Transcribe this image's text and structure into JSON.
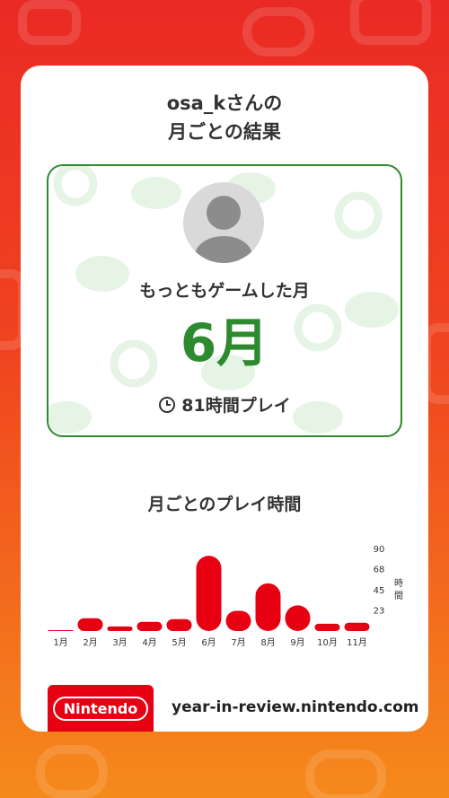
{
  "header": {
    "user_line": "osa_kさんの",
    "subtitle_line": "月ごとの結果"
  },
  "highlight": {
    "label": "もっともゲームした月",
    "month": "6月",
    "hours": "81時間プレイ"
  },
  "chart_data": {
    "type": "bar",
    "title": "月ごとのプレイ時間",
    "ylabel": "時間",
    "categories": [
      "1月",
      "2月",
      "3月",
      "4月",
      "5月",
      "6月",
      "7月",
      "8月",
      "9月",
      "10月",
      "11月"
    ],
    "values": [
      0.5,
      14,
      5,
      10,
      13,
      82,
      22,
      52,
      28,
      8,
      9
    ],
    "yticks": [
      23,
      45,
      68,
      90
    ],
    "ylim": [
      0,
      90
    ],
    "bar_color": "#e60012"
  },
  "footer": {
    "brand": "Nintendo",
    "url": "year-in-review.nintendo.com"
  },
  "colors": {
    "accent_green": "#2e8a2f",
    "nintendo_red": "#e60012"
  }
}
